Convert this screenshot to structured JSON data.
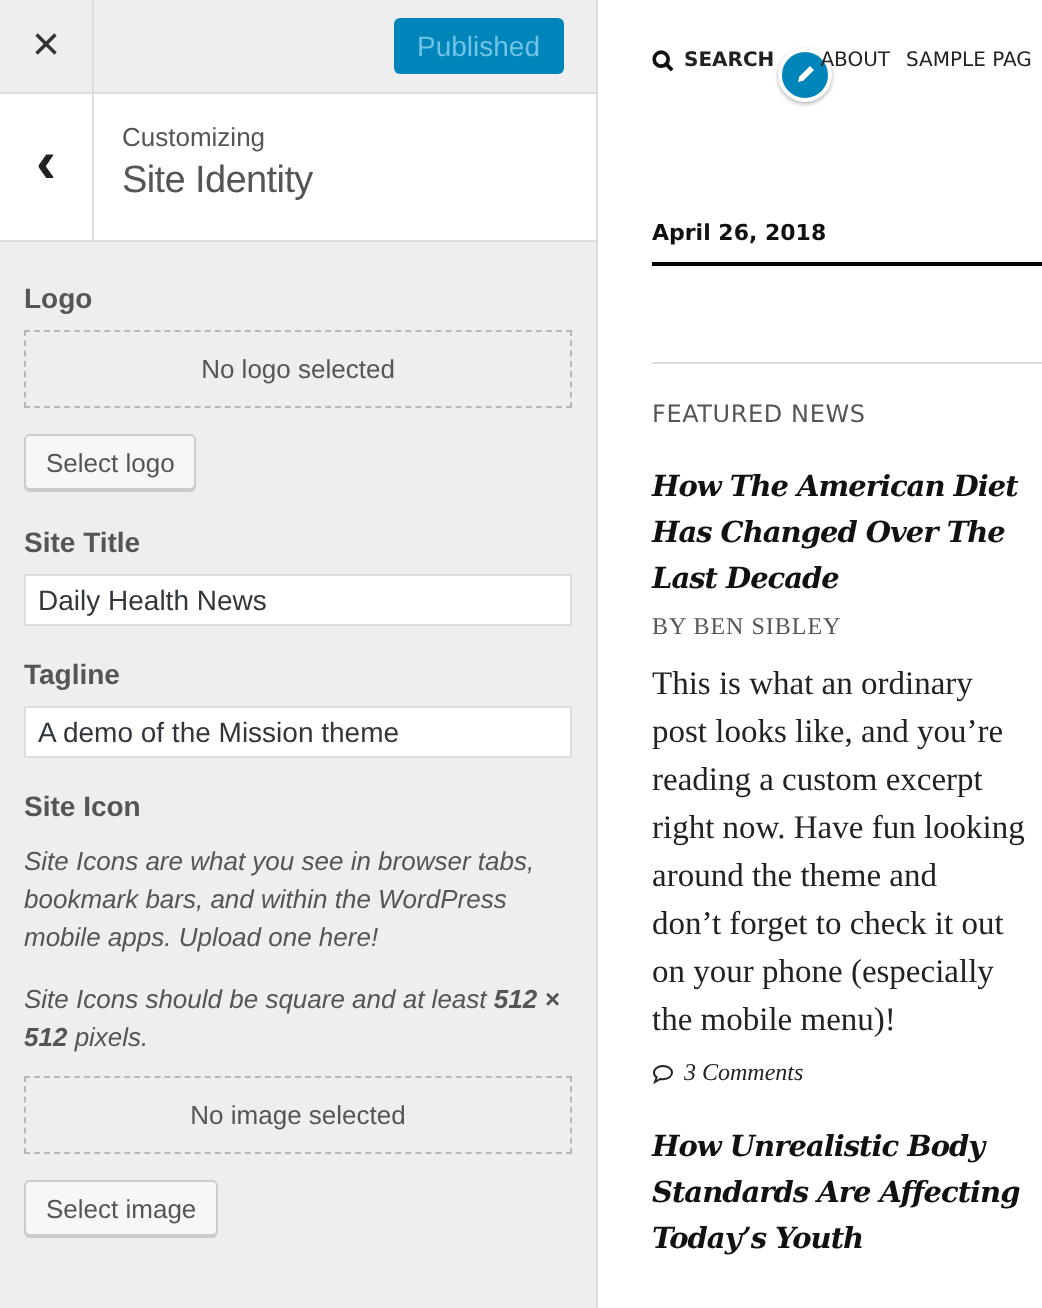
{
  "topbar": {
    "close": "×",
    "publish_button": "Published"
  },
  "header": {
    "back": "‹",
    "eyebrow": "Customizing",
    "title": "Site Identity"
  },
  "sections": [
    {
      "kind": "media",
      "label": "Logo",
      "placeholder_box": "No logo selected",
      "button": "Select logo"
    },
    {
      "kind": "text",
      "label": "Site Title",
      "value": "Daily Health News"
    },
    {
      "kind": "text",
      "label": "Tagline",
      "value": "A demo of the Mission theme"
    },
    {
      "kind": "media",
      "label": "Site Icon",
      "notes": [
        "Site Icons are what you see in browser tabs, bookmark bars, and within the WordPress mobile apps. Upload one here!",
        "Site Icons should be square and at least **512 × 512** pixels."
      ],
      "placeholder_box": "No image selected",
      "button": "Select image"
    }
  ],
  "preview": {
    "nav": [
      {
        "kind": "search",
        "label": "SEARCH"
      },
      {
        "kind": "link",
        "label": "ABOUT"
      },
      {
        "kind": "link",
        "label": "SAMPLE PAG"
      }
    ],
    "date": "April 26, 2018",
    "section_title": "FEATURED NEWS",
    "posts": [
      {
        "title": "How The American Diet\nHas Changed Over The\nLast Decade",
        "byline": "BY BEN SIBLEY",
        "excerpt": "This is what an ordinary\npost looks like, and you’re\nreading a custom excerpt\nright now. Have fun looking\naround the theme and\ndon’t forget to check it out\non your phone (especially\nthe mobile menu)!",
        "comments": "3 Comments"
      },
      {
        "title": "How Unrealistic Body\nStandards Are Affecting\nToday’s Youth"
      }
    ]
  }
}
